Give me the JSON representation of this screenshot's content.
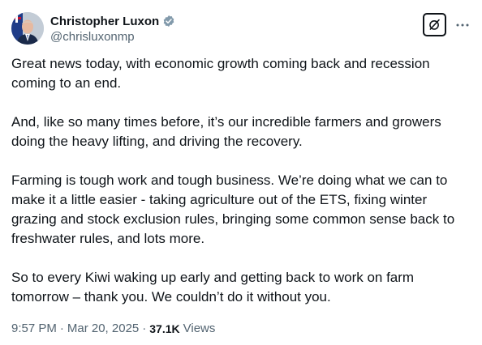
{
  "author": {
    "display_name": "Christopher Luxon",
    "handle": "@chrisluxonmp",
    "verified": true,
    "verified_badge_color": "#829aab"
  },
  "tweet": {
    "paragraphs": [
      "Great news today, with economic growth coming back and recession\ncoming to an end.",
      "And, like so many times before, it’s our incredible farmers and growers\ndoing the heavy lifting, and driving the recovery.",
      "Farming is tough work and tough business. We’re doing what we can to\nmake it a little easier - taking agriculture out of the ETS, fixing winter\ngrazing and stock exclusion rules, bringing some common sense back to\nfreshwater rules, and lots more.",
      "So to every Kiwi waking up early and getting back to work on farm\ntomorrow – thank you. We couldn’t do it without you."
    ]
  },
  "meta": {
    "time": "9:57 PM",
    "separator": "·",
    "date": "Mar 20, 2025",
    "views_count": "37.1K",
    "views_label": "Views"
  },
  "icons": {
    "grok": "grok-icon",
    "more": "more-horizontal-icon"
  }
}
